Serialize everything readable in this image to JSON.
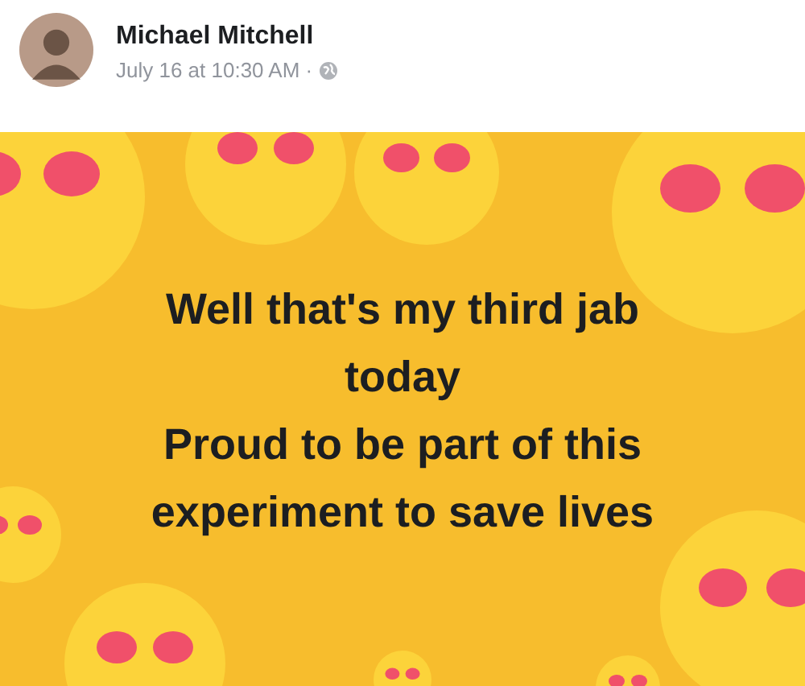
{
  "post": {
    "author": "Michael Mitchell",
    "timestamp": "July 16 at 10:30 AM ·",
    "public": true,
    "text": "Well that's my third jab today\nProud to be part of this experiment to save lives"
  }
}
